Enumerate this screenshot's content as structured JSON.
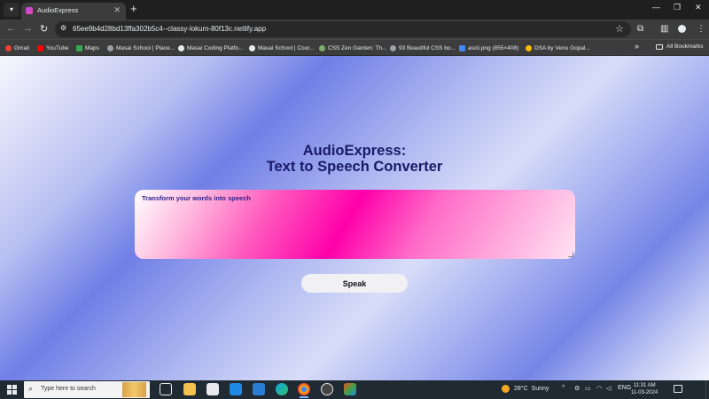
{
  "browser": {
    "tab_title": "AudioExpress",
    "url": "65ee9b4d28bd13ffa302b5c4--classy-lokum-80f13c.netlify.app",
    "bookmarks": [
      {
        "label": "Gmail",
        "color": "#ea4335"
      },
      {
        "label": "YouTube",
        "color": "#ff0000"
      },
      {
        "label": "Maps",
        "color": "#34a853"
      },
      {
        "label": "Masai School | Place...",
        "color": "#9aa0a6"
      },
      {
        "label": "Masai Coding Platfo...",
        "color": "#e8eaed"
      },
      {
        "label": "Masai School | Cour...",
        "color": "#e8eaed"
      },
      {
        "label": "CSS Zen Garden: Th...",
        "color": "#7fb069"
      },
      {
        "label": "93 Beautiful CSS bo...",
        "color": "#9aa0a6"
      },
      {
        "label": "ascii.png (855×408)",
        "color": "#4285f4"
      },
      {
        "label": "DSA by Venu Gopal...",
        "color": "#fbbc05"
      }
    ],
    "all_bookmarks_label": "All Bookmarks"
  },
  "page": {
    "heading_line1": "AudioExpress:",
    "heading_line2": "Text to Speech Converter",
    "textarea_placeholder": "Transform your words into speech",
    "speak_label": "Speak"
  },
  "taskbar": {
    "search_placeholder": "Type here to search",
    "weather_temp": "28°C",
    "weather_desc": "Sunny",
    "language": "ENG",
    "time": "11:31 AM",
    "date": "11-03-2024"
  }
}
